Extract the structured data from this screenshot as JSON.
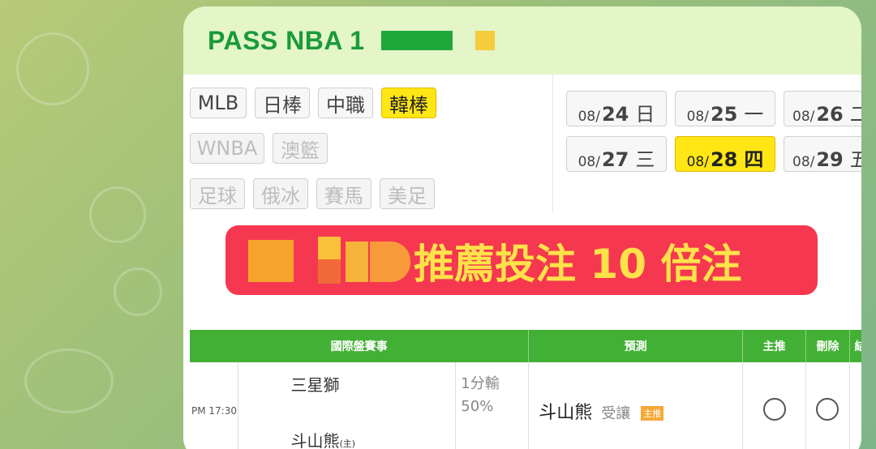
{
  "message": {
    "sender_visible": "PASS NBA 1"
  },
  "filters": {
    "sports": [
      {
        "label": "MLB",
        "state": "normal"
      },
      {
        "label": "日棒",
        "state": "normal"
      },
      {
        "label": "中職",
        "state": "normal"
      },
      {
        "label": "韓棒",
        "state": "selected"
      },
      {
        "label": "WNBA",
        "state": "dim"
      },
      {
        "label": "澳籃",
        "state": "dim"
      },
      {
        "label": "足球",
        "state": "dim"
      },
      {
        "label": "俄冰",
        "state": "dim"
      },
      {
        "label": "賽馬",
        "state": "dim"
      },
      {
        "label": "美足",
        "state": "dim"
      }
    ],
    "dates": [
      {
        "month": "08/",
        "day": "24",
        "weekday": "日",
        "selected": false
      },
      {
        "month": "08/",
        "day": "25",
        "weekday": "一",
        "selected": false
      },
      {
        "month": "08/",
        "day": "26",
        "weekday": "二",
        "selected": false
      },
      {
        "month": "08/",
        "day": "27",
        "weekday": "三",
        "selected": false
      },
      {
        "month": "08/",
        "day": "28",
        "weekday": "四",
        "selected": true
      },
      {
        "month": "08/",
        "day": "29",
        "weekday": "五",
        "selected": false
      }
    ]
  },
  "banner": {
    "text": "推薦投注 10 倍注"
  },
  "table": {
    "headers": [
      "國際盤賽事",
      "預測",
      "主推",
      "刪除",
      "結"
    ],
    "row": {
      "time": "PM 17:30",
      "away_team": "三星獅",
      "home_team": "斗山熊",
      "home_marker": "(主)",
      "line": "1分輸",
      "line_pct": "50%",
      "pick_team": "斗山熊",
      "pick_type": "受讓",
      "pick_badge": "主推"
    }
  },
  "colors": {
    "bubble_bg": "#e4f5c8",
    "sender": "#1a9a3a",
    "selected": "#ffe614",
    "banner": "#f5384f",
    "banner_text": "#ffe24a",
    "table_header": "#42b035"
  }
}
